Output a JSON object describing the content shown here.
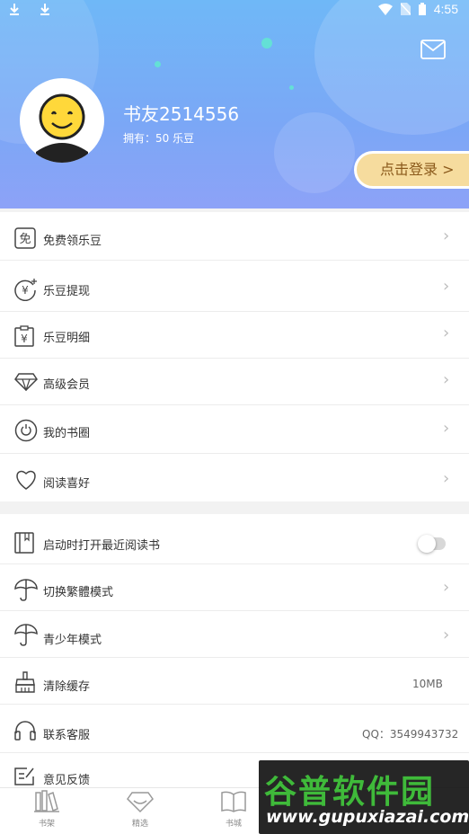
{
  "statusbar": {
    "time": "4:55",
    "left_icons": [
      "download-icon",
      "download-icon"
    ],
    "right_icons": [
      "wifi-icon",
      "no-sim-icon",
      "battery-icon"
    ]
  },
  "profile": {
    "username": "书友2514556",
    "beans": "拥有：50 乐豆",
    "login_label": "点击登录 >",
    "mail_icon": "mail-icon"
  },
  "menu_group1": [
    {
      "label": "免费领乐豆",
      "icon": "free-badge-icon"
    },
    {
      "label": "乐豆提现",
      "icon": "yuan-coin-icon"
    },
    {
      "label": "乐豆明细",
      "icon": "clipboard-yuan-icon"
    },
    {
      "label": "高级会员",
      "icon": "diamond-icon"
    },
    {
      "label": "我的书圈",
      "icon": "circle-refresh-icon"
    },
    {
      "label": "阅读喜好",
      "icon": "heart-icon"
    }
  ],
  "menu_group2": [
    {
      "label": "启动时打开最近阅读书",
      "icon": "book-icon",
      "toggle": false
    },
    {
      "label": "切换繁體模式",
      "icon": "umbrella-icon"
    },
    {
      "label": "青少年模式",
      "icon": "umbrella-icon"
    },
    {
      "label": "清除缓存",
      "icon": "broom-icon",
      "value": "10MB"
    },
    {
      "label": "联系客服",
      "icon": "headset-icon",
      "value": "QQ：3549943732"
    },
    {
      "label": "意见反馈",
      "icon": "feedback-icon"
    }
  ],
  "bottom_nav": [
    {
      "label": "书架",
      "icon": "bookshelf-icon"
    },
    {
      "label": "精选",
      "icon": "diamond-icon"
    },
    {
      "label": "书城",
      "icon": "open-book-icon"
    }
  ],
  "watermark": {
    "title": "谷普软件园",
    "url": "www.gupuxiazai.com"
  },
  "colors": {
    "header_top": "#6fb8f7",
    "header_bottom": "#8da2f7",
    "login_bg": "#f6dc9e",
    "login_text": "#8b5a1b"
  }
}
